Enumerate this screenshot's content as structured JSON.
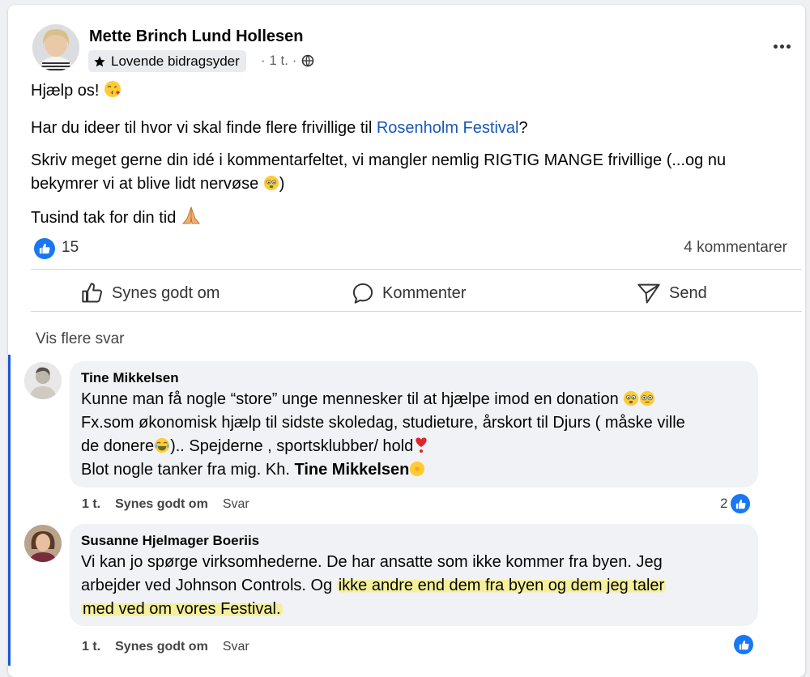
{
  "post": {
    "author": "Mette Brinch Lund Hollesen",
    "badge_label": "Lovende bidragsyder",
    "time": "· 1 t. ·",
    "line1": "Hjælp os!",
    "line2_prefix": "Har du ideer til hvor vi skal finde flere frivillige til ",
    "line2_link": "Rosenholm Festival",
    "line2_suffix": "?",
    "line3a": "Skriv meget gerne din idé i kommentarfeltet, vi mangler nemlig RIGTIG MANGE frivillige (...og nu",
    "line3b": "bekymrer vi at blive lidt nervøse",
    "line3b_end": ")",
    "line4": "Tusind tak for din tid"
  },
  "stats": {
    "likes": "15",
    "comments": "4 kommentarer"
  },
  "actions": {
    "like": "Synes godt om",
    "comment": "Kommenter",
    "send": "Send"
  },
  "comments_section": {
    "show_more": "Vis flere svar",
    "items": [
      {
        "name": "Tine Mikkelsen",
        "l1": "Kunne man få nogle “store” unge mennesker til at hjælpe imod en donation",
        "l2": "Fx.som økonomisk hjælp til sidste skoledag, studieture, årskort til Djurs ( måske ville",
        "l3a": "de donere",
        "l3b": ").. Spejderne , sportsklubber/ hold",
        "l4a": "Blot nogle tanker fra mig. Kh. ",
        "l4b": "Tine Mikkelsen",
        "time": "1 t.",
        "like_label": "Synes godt om",
        "reply_label": "Svar",
        "likes": "2"
      },
      {
        "name": "Susanne Hjelmager Boeriis",
        "l1": "Vi kan jo spørge virksomhederne. De har ansatte som ikke kommer fra byen. Jeg",
        "l2a": "arbejder ved Johnson Controls. Og ",
        "l2b": "ikke andre end dem fra byen og dem jeg taler",
        "l3": "med ved om vores Festival.",
        "time": "1 t.",
        "like_label": "Synes godt om",
        "reply_label": "Svar"
      }
    ]
  },
  "colors": {
    "link": "#1a57b8",
    "like_blue": "#1877f2",
    "highlight": "#f4ef9a",
    "bubble": "#f0f2f5"
  },
  "icons": [
    "star-icon",
    "globe-icon",
    "more-icon",
    "kiss-emoji-icon",
    "worried-emoji-icon",
    "pray-emoji-icon",
    "thumbs-up-icon",
    "comment-icon",
    "send-icon",
    "heart-icon",
    "smile-icon"
  ]
}
